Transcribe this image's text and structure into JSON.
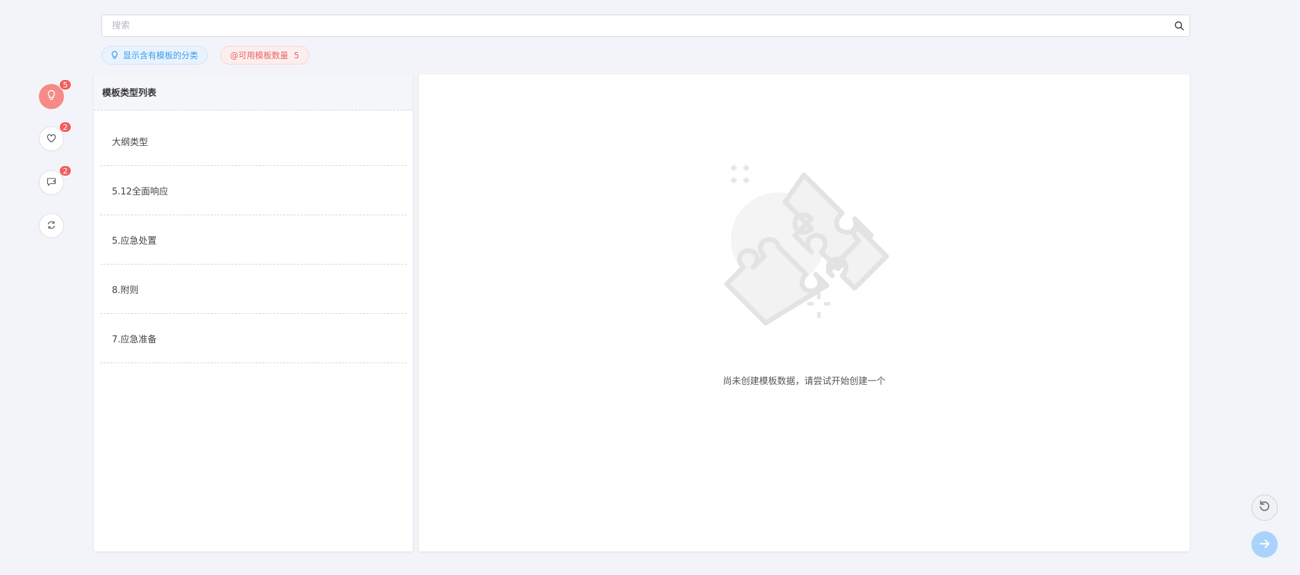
{
  "search": {
    "placeholder": "搜索",
    "icon": "search-icon"
  },
  "tags": {
    "show_categories": {
      "label": "显示含有模板的分类",
      "icon": "lightbulb-icon"
    },
    "available_count": {
      "label": "@可用模板数量",
      "count": "5"
    }
  },
  "rail": [
    {
      "name": "lightbulb",
      "icon": "lightbulb-icon",
      "badge": "5",
      "active": true
    },
    {
      "name": "favorites",
      "icon": "heart-icon",
      "badge": "2",
      "active": false
    },
    {
      "name": "comments",
      "icon": "comment-add-icon",
      "badge": "2",
      "active": false
    },
    {
      "name": "refresh",
      "icon": "refresh-icon",
      "badge": "",
      "active": false
    }
  ],
  "left_panel": {
    "title": "模板类型列表",
    "items": [
      "大纲类型",
      "5.12全面响应",
      "5.应急处置",
      "8.附则",
      "7.应急准备"
    ]
  },
  "right_panel": {
    "empty_text": "尚未创建模板数据，请尝试开始创建一个",
    "illustration": "puzzle-pieces-illustration"
  },
  "fabs": [
    {
      "name": "undo",
      "icon": "undo-icon"
    },
    {
      "name": "next",
      "icon": "arrow-right-icon"
    }
  ],
  "colors": {
    "background": "#f3f4f9",
    "active_red": "#f58a87",
    "badge_red": "#ef5f5f",
    "tag_blue": "#3b9be8",
    "tag_red": "#e66767",
    "fab_blue": "#a9d3fb"
  }
}
